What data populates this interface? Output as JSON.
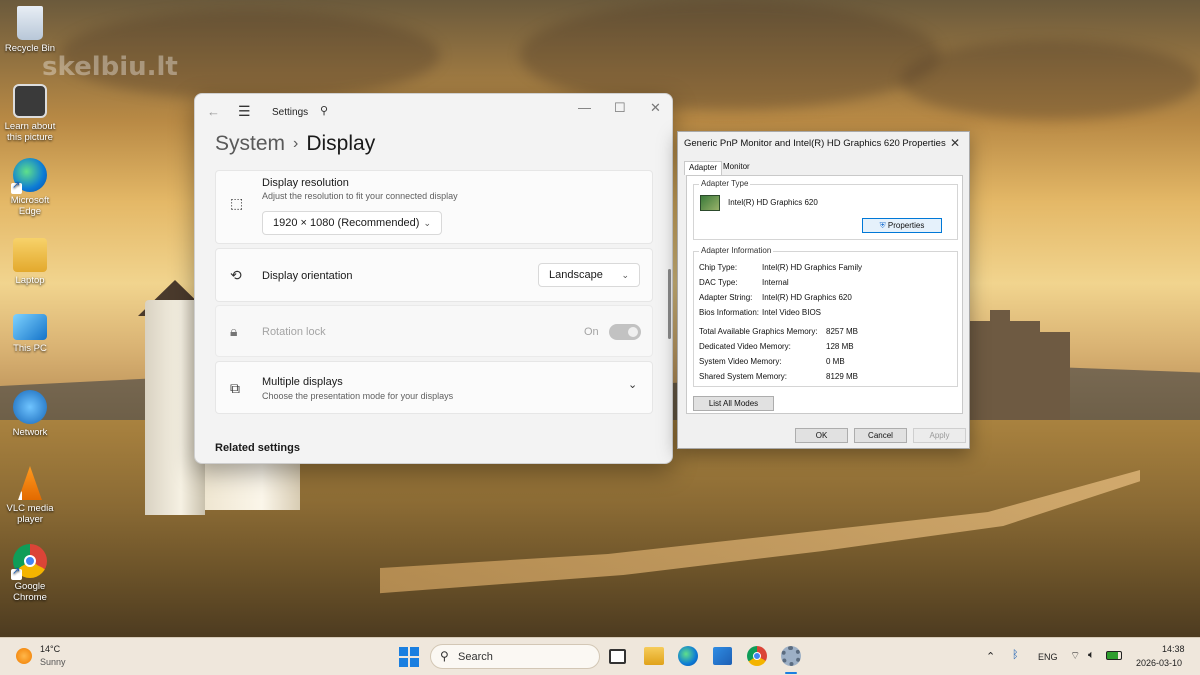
{
  "desktop": {
    "watermark": "skelbiu.lt",
    "icons": [
      {
        "label": "Recycle Bin"
      },
      {
        "label": "Learn about this picture"
      },
      {
        "label": "Microsoft Edge"
      },
      {
        "label": "Laptop"
      },
      {
        "label": "This PC"
      },
      {
        "label": "Network"
      },
      {
        "label": "VLC media player"
      },
      {
        "label": "Google Chrome"
      }
    ]
  },
  "settings": {
    "app_title": "Settings",
    "breadcrumb_parent": "System",
    "breadcrumb_current": "Display",
    "resolution": {
      "label": "Display resolution",
      "description": "Adjust the resolution to fit your connected display",
      "value": "1920 × 1080 (Recommended)"
    },
    "orientation": {
      "label": "Display orientation",
      "value": "Landscape"
    },
    "rotation_lock": {
      "label": "Rotation lock",
      "state": "On"
    },
    "multiple_displays": {
      "label": "Multiple displays",
      "description": "Choose the presentation mode for your displays"
    },
    "related_heading": "Related settings"
  },
  "properties_dialog": {
    "title": "Generic PnP Monitor and Intel(R) HD Graphics 620 Properties",
    "tabs": [
      "Adapter",
      "Monitor"
    ],
    "active_tab": "Adapter",
    "adapter_type_label": "Adapter Type",
    "adapter_name": "Intel(R) HD Graphics 620",
    "properties_button": "Properties",
    "adapter_info_label": "Adapter Information",
    "info_rows": [
      {
        "key": "Chip Type:",
        "value": "Intel(R) HD Graphics Family"
      },
      {
        "key": "DAC Type:",
        "value": "Internal"
      },
      {
        "key": "Adapter String:",
        "value": "Intel(R) HD Graphics 620"
      },
      {
        "key": "Bios Information:",
        "value": "Intel Video BIOS"
      }
    ],
    "memory_rows": [
      {
        "key": "Total Available Graphics Memory:",
        "value": "8257 MB"
      },
      {
        "key": "Dedicated Video Memory:",
        "value": "128 MB"
      },
      {
        "key": "System Video Memory:",
        "value": "0 MB"
      },
      {
        "key": "Shared System Memory:",
        "value": "8129 MB"
      }
    ],
    "list_modes_button": "List All Modes",
    "ok_button": "OK",
    "cancel_button": "Cancel",
    "apply_button": "Apply"
  },
  "taskbar": {
    "weather_temp": "14°C",
    "weather_desc": "Sunny",
    "search_placeholder": "Search",
    "language": "ENG",
    "time": "14:38",
    "date": "2026-03-10"
  },
  "colors": {
    "accent": "#0078d7",
    "taskbar_bg": "#efe7dc",
    "settings_bg": "#f3f3f3"
  }
}
